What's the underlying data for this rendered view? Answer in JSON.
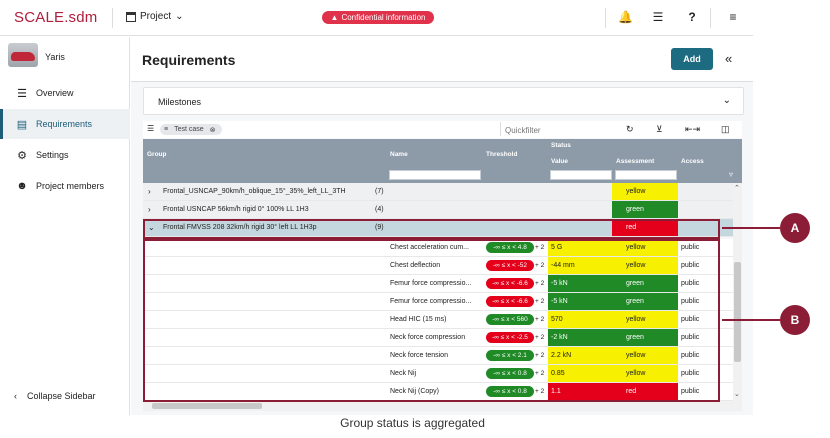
{
  "header": {
    "logo": "SCALE.sdm",
    "project_label": "Project",
    "confidential": "Confidential information"
  },
  "sidebar": {
    "vehicle": "Yaris",
    "items": [
      {
        "label": "Overview",
        "icon": "list-icon"
      },
      {
        "label": "Requirements",
        "icon": "chart-icon"
      },
      {
        "label": "Settings",
        "icon": "gear-icon"
      },
      {
        "label": "Project members",
        "icon": "users-icon"
      }
    ],
    "collapse": "Collapse Sidebar"
  },
  "main": {
    "title": "Requirements",
    "add_label": "Add",
    "milestones": "Milestones",
    "chip": "Test case",
    "quickfilter": "Quickfilter"
  },
  "grid": {
    "headers": {
      "group": "Group",
      "name": "Name",
      "threshold": "Threshold",
      "status": "Status",
      "value": "Value",
      "assessment": "Assessment",
      "access": "Access"
    },
    "groups": [
      {
        "label": "Frontal_USNCAP_90km/h_oblique_15°_35%_left_LL_3TH",
        "count": "(7)",
        "assessment": "yellow"
      },
      {
        "label": "Frontal USNCAP 56km/h rigid 0° 100% LL 1H3",
        "count": "(4)",
        "assessment": "green"
      },
      {
        "label": "Frontal FMVSS 208 32km/h rigid 30° left LL 1H3p",
        "count": "(9)",
        "assessment": "red"
      }
    ],
    "rows": [
      {
        "name": "Chest acceleration cum...",
        "threshold": "-∞ ≤ x < 4.8",
        "tcolor": "g",
        "value": "5 G",
        "vcolor": "y",
        "assessment": "yellow",
        "acolor": "y",
        "access": "public"
      },
      {
        "name": "Chest deflection",
        "threshold": "-∞ ≤ x < -52",
        "tcolor": "r",
        "value": "-44 mm",
        "vcolor": "y",
        "assessment": "yellow",
        "acolor": "y",
        "access": "public"
      },
      {
        "name": "Femur force compressio...",
        "threshold": "-∞ ≤ x < -6.6",
        "tcolor": "r",
        "value": "-5 kN",
        "vcolor": "gr",
        "assessment": "green",
        "acolor": "gr",
        "access": "public"
      },
      {
        "name": "Femur force compressio...",
        "threshold": "-∞ ≤ x < -6.6",
        "tcolor": "r",
        "value": "-5 kN",
        "vcolor": "gr",
        "assessment": "green",
        "acolor": "gr",
        "access": "public"
      },
      {
        "name": "Head HIC (15 ms)",
        "threshold": "-∞ ≤ x < 560",
        "tcolor": "g",
        "value": "570",
        "vcolor": "y",
        "assessment": "yellow",
        "acolor": "y",
        "access": "public"
      },
      {
        "name": "Neck force compression",
        "threshold": "-∞ ≤ x < -2.5",
        "tcolor": "r",
        "value": "-2 kN",
        "vcolor": "gr",
        "assessment": "green",
        "acolor": "gr",
        "access": "public"
      },
      {
        "name": "Neck force tension",
        "threshold": "-∞ ≤ x < 2.1",
        "tcolor": "g",
        "value": "2.2 kN",
        "vcolor": "y",
        "assessment": "yellow",
        "acolor": "y",
        "access": "public"
      },
      {
        "name": "Neck Nij",
        "threshold": "-∞ ≤ x < 0.8",
        "tcolor": "g",
        "value": "0.85",
        "vcolor": "y",
        "assessment": "yellow",
        "acolor": "y",
        "access": "public"
      },
      {
        "name": "Neck Nij (Copy)",
        "threshold": "-∞ ≤ x < 0.8",
        "tcolor": "g",
        "value": "1.1",
        "vcolor": "rd",
        "assessment": "red",
        "acolor": "rd",
        "access": "public"
      }
    ],
    "plus": "+ 2"
  },
  "callouts": {
    "a": "A",
    "b": "B"
  },
  "caption": "Group status is aggregated"
}
